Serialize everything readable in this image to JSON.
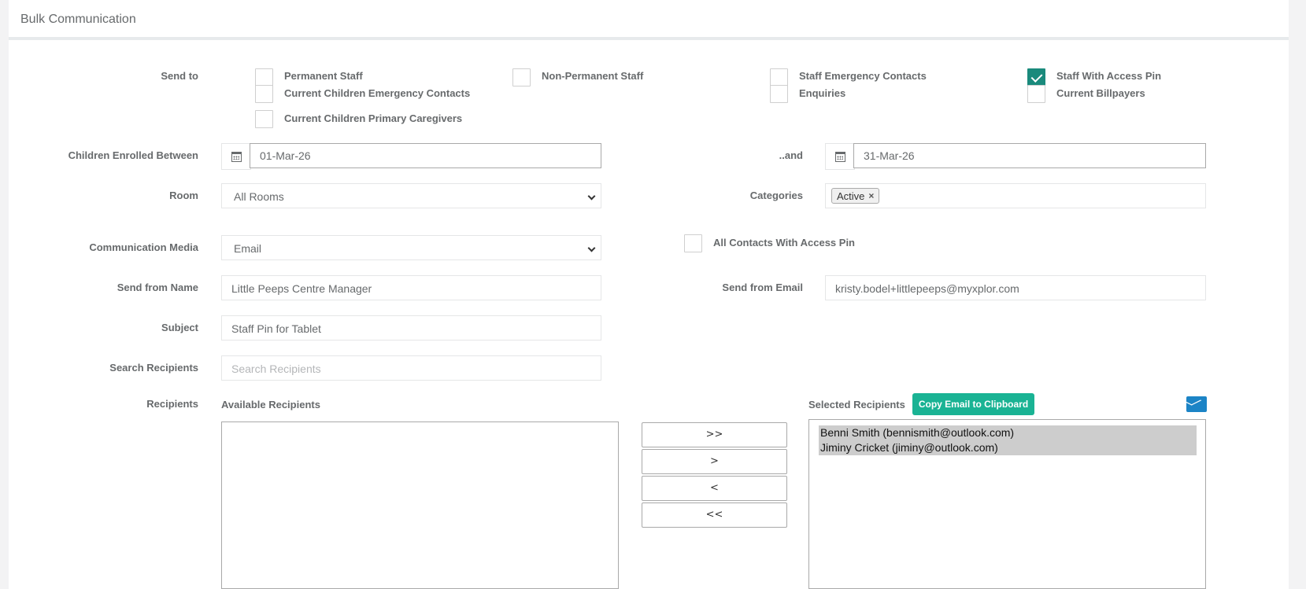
{
  "header": {
    "title": "Bulk Communication"
  },
  "send_to": {
    "label": "Send to",
    "options": [
      {
        "label": "Permanent Staff",
        "checked": false
      },
      {
        "label": "Non-Permanent Staff",
        "checked": false
      },
      {
        "label": "Staff Emergency Contacts",
        "checked": false
      },
      {
        "label": "Staff With Access Pin",
        "checked": true
      },
      {
        "label": "Current Children Emergency Contacts",
        "checked": false
      },
      {
        "label": "Enquiries",
        "checked": false
      },
      {
        "label": "Current Billpayers",
        "checked": false
      },
      {
        "label": "Current Children Primary Caregivers",
        "checked": false
      }
    ]
  },
  "enrolled": {
    "label": "Children Enrolled Between",
    "from": "01-Mar-26",
    "and_label": "..and",
    "to": "31-Mar-26"
  },
  "room": {
    "label": "Room",
    "value": "All Rooms"
  },
  "categories": {
    "label": "Categories",
    "tags": [
      "Active"
    ],
    "remove_glyph": "×"
  },
  "media": {
    "label": "Communication Media",
    "value": "Email"
  },
  "access_pin": {
    "label": "All Contacts With Access Pin",
    "checked": false
  },
  "send_from_name": {
    "label": "Send from Name",
    "value": "Little Peeps Centre Manager"
  },
  "send_from_email": {
    "label": "Send from Email",
    "value": "kristy.bodel+littlepeeps@myxplor.com"
  },
  "subject": {
    "label": "Subject",
    "value": "Staff Pin for Tablet"
  },
  "search": {
    "label": "Search Recipients",
    "placeholder": "Search Recipients"
  },
  "recipients": {
    "label": "Recipients",
    "available_label": "Available Recipients",
    "selected_label": "Selected Recipients",
    "copy_button": "Copy Email to Clipboard",
    "move_buttons": [
      ">>",
      ">",
      "<",
      "<<"
    ],
    "available": [],
    "selected": [
      "Benni Smith (bennismith@outlook.com)",
      "Jiminy Cricket (jiminy@outlook.com)"
    ]
  },
  "icons": {
    "calendar": "calendar-icon",
    "email": "envelope-icon"
  },
  "colors": {
    "checked": "#1a8a7c",
    "primary_button": "#1ab394",
    "envelope": "#1c84c6"
  }
}
